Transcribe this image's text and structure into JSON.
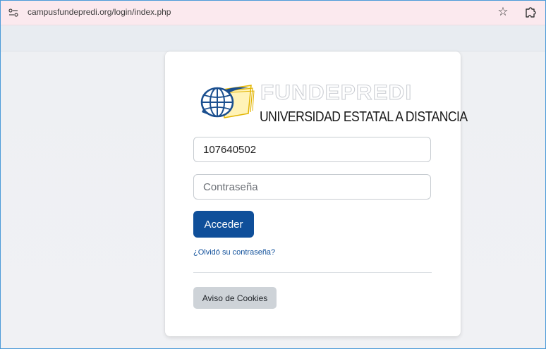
{
  "browser": {
    "url": "campusfundepredi.org/login/index.php"
  },
  "logo": {
    "wordmark": "FUNDEPREDI",
    "subtitle": "UNIVERSIDAD ESTATAL A DISTANCIA"
  },
  "login": {
    "username_value": "107640502",
    "password_placeholder": "Contraseña",
    "submit_label": "Acceder",
    "forgot_label": "¿Olvidó su contraseña?",
    "cookies_label": "Aviso de Cookies"
  },
  "colors": {
    "primary": "#0f4f9a",
    "logo_blue": "#1b4f8f",
    "logo_gold": "#e2b400"
  },
  "icons": {
    "site_info": "site-info-icon",
    "bookmark": "star-icon",
    "extensions": "puzzle-icon"
  }
}
